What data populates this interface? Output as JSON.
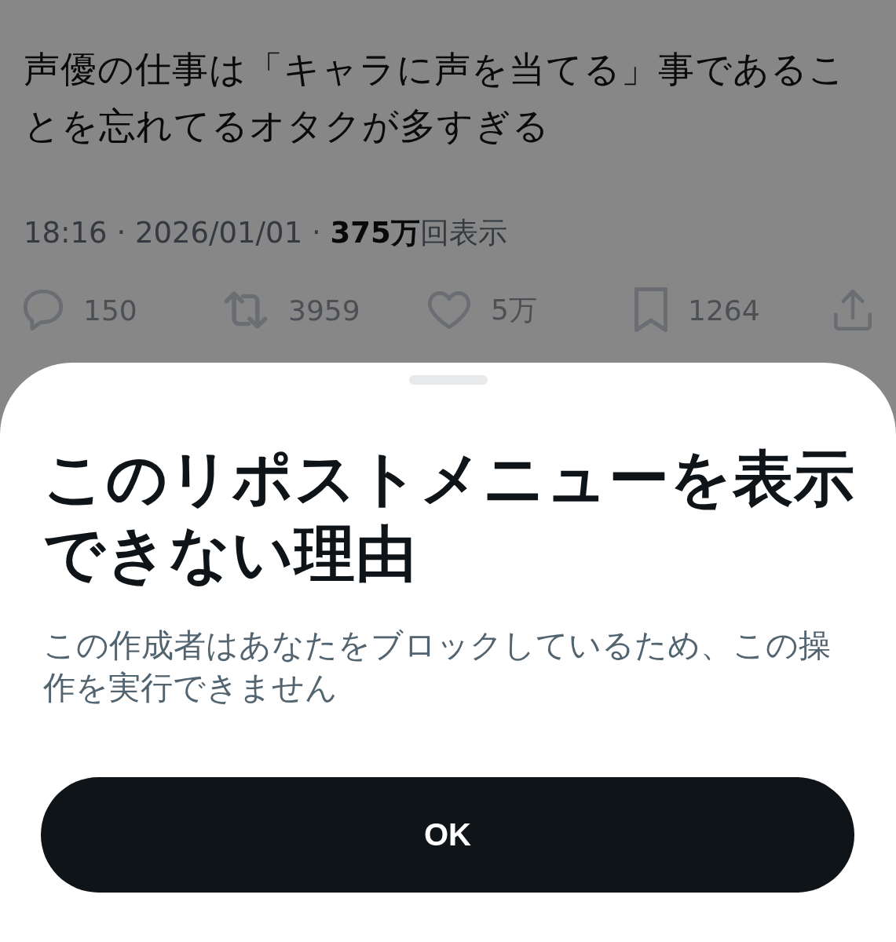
{
  "post": {
    "text": "声優の仕事は「キャラに声を当てる」事であることを忘れてるオタクが多すぎる",
    "meta": "18:16 · 2026/01/01 · **375万**回表示",
    "actions": [
      {
        "kind": "reply",
        "count": "150"
      },
      {
        "kind": "repost",
        "count": "3959"
      },
      {
        "kind": "like",
        "count": "5万"
      },
      {
        "kind": "bookmark",
        "count": "1264"
      },
      {
        "kind": "share"
      }
    ]
  },
  "sheet": {
    "title": "このリポストメニューを表示できない理由",
    "message": "この作成者はあなたをブロックしているため、この操作を実行できません",
    "button": "OK"
  }
}
